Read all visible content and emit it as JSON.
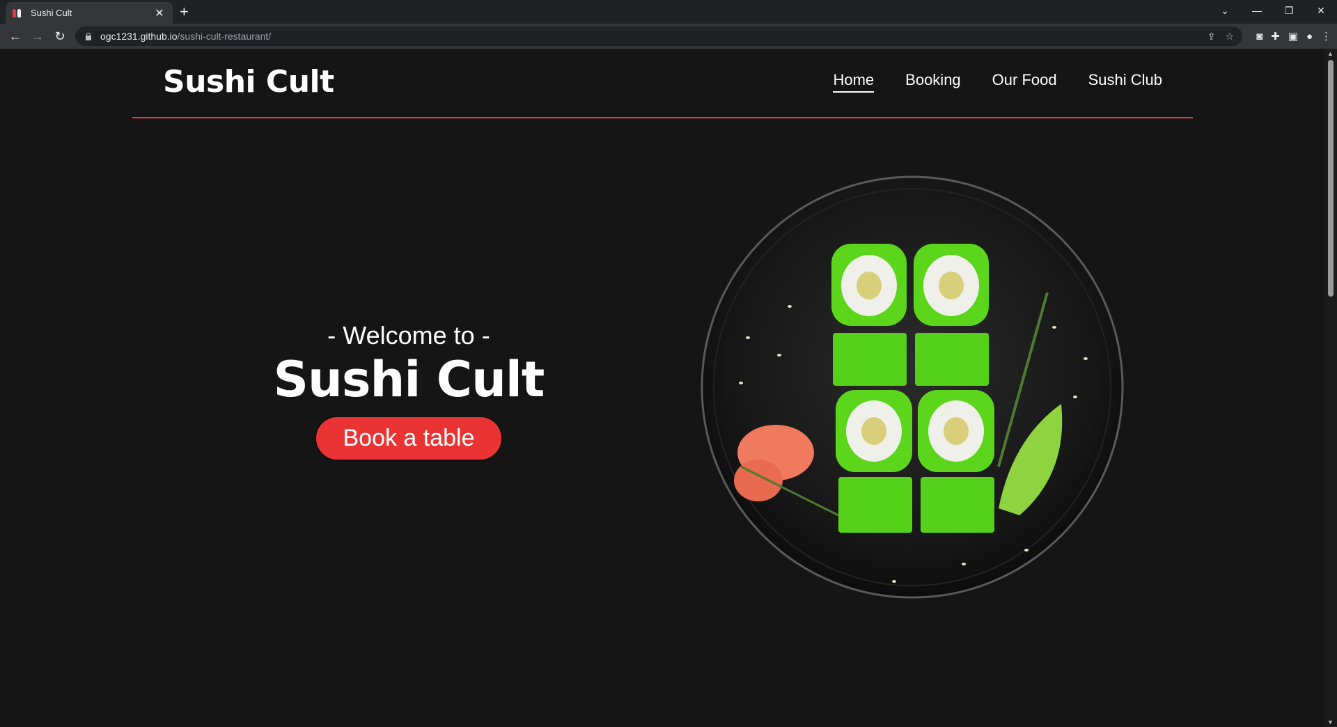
{
  "browser": {
    "tab_title": "Sushi Cult",
    "url_host": "ogc1231.github.io",
    "url_path": "/sushi-cult-restaurant/"
  },
  "site": {
    "logo": "Sushi Cult",
    "nav": [
      {
        "label": "Home",
        "active": true
      },
      {
        "label": "Booking",
        "active": false
      },
      {
        "label": "Our Food",
        "active": false
      },
      {
        "label": "Sushi Club",
        "active": false
      }
    ],
    "hero": {
      "welcome": "- Welcome to -",
      "title": "Sushi Cult",
      "cta": "Book a table"
    }
  },
  "colors": {
    "background": "#151515",
    "accent": "#ea3434",
    "text": "#ffffff"
  }
}
